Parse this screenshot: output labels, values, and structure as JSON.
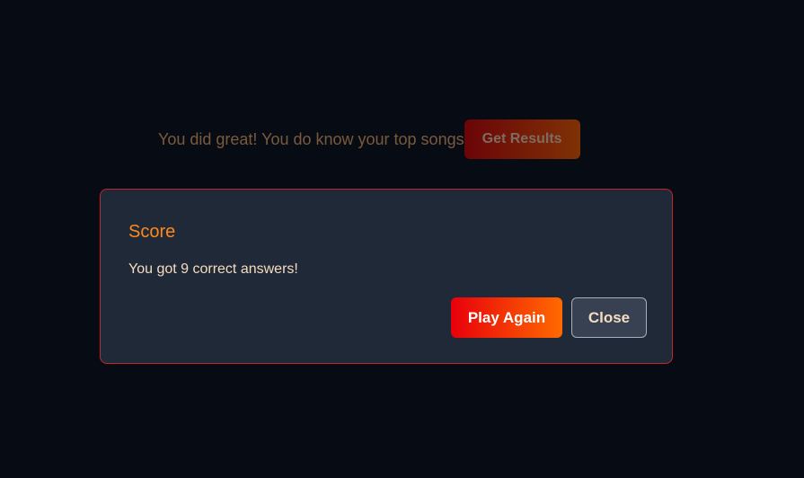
{
  "page": {
    "result_text": "You did great! You do know your top songs",
    "get_results_label": "Get Results"
  },
  "dialog": {
    "title": "Score",
    "message": "You got 9 correct answers!",
    "play_again_label": "Play Again",
    "close_label": "Close"
  }
}
